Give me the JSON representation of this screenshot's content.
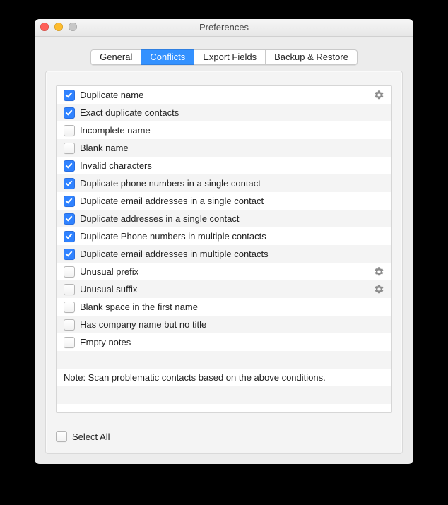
{
  "window": {
    "title": "Preferences"
  },
  "tabs": [
    {
      "label": "General",
      "active": false
    },
    {
      "label": "Conflicts",
      "active": true
    },
    {
      "label": "Export Fields",
      "active": false
    },
    {
      "label": "Backup & Restore",
      "active": false
    }
  ],
  "items": [
    {
      "label": "Duplicate name",
      "checked": true,
      "gear": true
    },
    {
      "label": "Exact duplicate contacts",
      "checked": true,
      "gear": false
    },
    {
      "label": "Incomplete name",
      "checked": false,
      "gear": false
    },
    {
      "label": "Blank name",
      "checked": false,
      "gear": false
    },
    {
      "label": "Invalid characters",
      "checked": true,
      "gear": false
    },
    {
      "label": "Duplicate phone numbers in a single contact",
      "checked": true,
      "gear": false
    },
    {
      "label": "Duplicate email addresses in a single contact",
      "checked": true,
      "gear": false
    },
    {
      "label": "Duplicate addresses in a single contact",
      "checked": true,
      "gear": false
    },
    {
      "label": "Duplicate Phone numbers in multiple contacts",
      "checked": true,
      "gear": false
    },
    {
      "label": "Duplicate email addresses in multiple contacts",
      "checked": true,
      "gear": false
    },
    {
      "label": "Unusual prefix",
      "checked": false,
      "gear": true
    },
    {
      "label": "Unusual suffix",
      "checked": false,
      "gear": true
    },
    {
      "label": "Blank space in the first name",
      "checked": false,
      "gear": false
    },
    {
      "label": "Has company name but no title",
      "checked": false,
      "gear": false
    },
    {
      "label": "Empty notes",
      "checked": false,
      "gear": false
    }
  ],
  "note": "Note: Scan problematic contacts based on the above conditions.",
  "selectAll": {
    "label": "Select All",
    "checked": false
  }
}
